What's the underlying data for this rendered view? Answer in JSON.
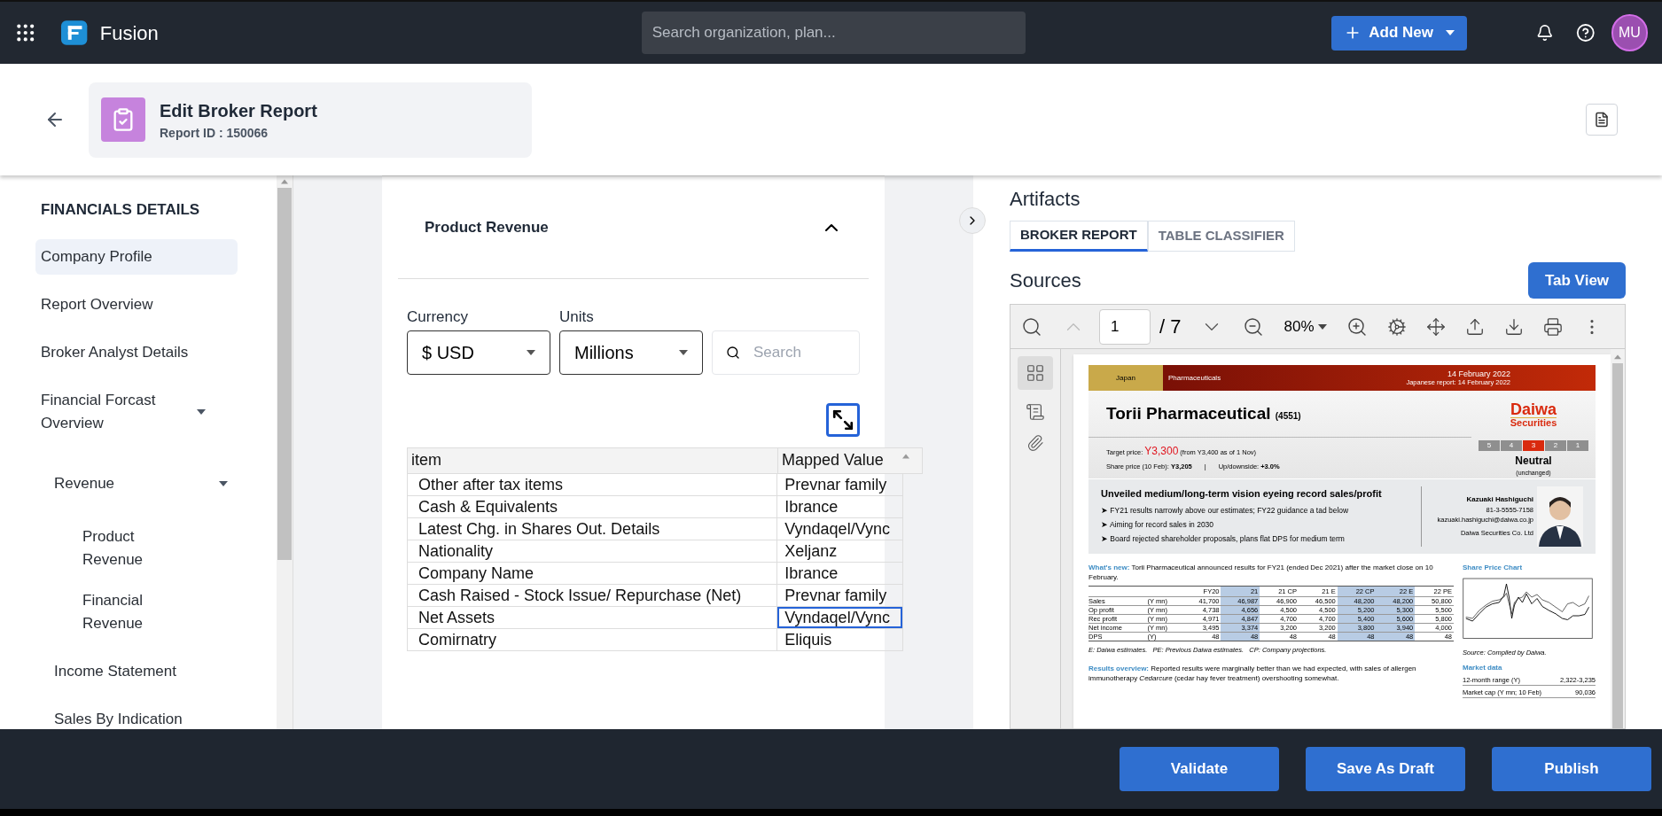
{
  "app": {
    "name": "Fusion"
  },
  "search": {
    "placeholder": "Search organization, plan..."
  },
  "add_button": "Add New",
  "avatar": "MU",
  "page_header": {
    "title": "Edit Broker Report",
    "subtitle": "Report ID : 150066"
  },
  "sidebar": {
    "heading": "FINANCIALS DETAILS",
    "items": [
      {
        "label": "Company Profile",
        "selected": true
      },
      {
        "label": "Report Overview",
        "selected": false
      },
      {
        "label": "Broker Analyst Details",
        "selected": false
      },
      {
        "label": "Financial Forcast Overview",
        "selected": false,
        "expanded": true,
        "children": [
          {
            "label": "Revenue",
            "selected": false,
            "expanded": true,
            "children": [
              {
                "label": "Product Revenue",
                "selected": false
              },
              {
                "label": "Financial Revenue",
                "selected": false
              }
            ]
          },
          {
            "label": "Income Statement",
            "selected": false
          },
          {
            "label": "Sales By Indication",
            "selected": false
          }
        ]
      }
    ]
  },
  "section": {
    "title": "Product Revenue",
    "expanded": true
  },
  "filters": [
    {
      "label": "Currency",
      "value": "$ USD"
    },
    {
      "label": "Units",
      "value": "Millions"
    }
  ],
  "table_search": {
    "placeholder": "Search"
  },
  "table": {
    "columns": [
      "item",
      "Mapped Value"
    ],
    "rows": [
      {
        "item": "Other after tax items",
        "mapped": "Prevnar family",
        "selected": false
      },
      {
        "item": "Cash & Equivalents",
        "mapped": "Ibrance",
        "selected": false
      },
      {
        "item": "Latest Chg. in Shares Out. Details",
        "mapped": "Vyndaqel/Vync",
        "selected": false
      },
      {
        "item": "Nationality",
        "mapped": "Xeljanz",
        "selected": false
      },
      {
        "item": "Company Name",
        "mapped": "Ibrance",
        "selected": false
      },
      {
        "item": "Cash Raised - Stock Issue/ Repurchase (Net)",
        "mapped": "Prevnar family",
        "selected": false
      },
      {
        "item": "Net Assets",
        "mapped": "Vyndaqel/Vync",
        "selected": true
      },
      {
        "item": "Comirnatry",
        "mapped": "Eliquis",
        "selected": false
      }
    ]
  },
  "artifacts": {
    "title": "Artifacts",
    "tabs": [
      {
        "label": "BROKER REPORT",
        "selected": true
      },
      {
        "label": "TABLE CLASSIFIER",
        "selected": false
      }
    ]
  },
  "sources": {
    "title": "Sources",
    "button": "Tab View"
  },
  "viewer": {
    "page": "1",
    "pages": "/ 7",
    "zoom": "80%"
  },
  "document": {
    "region": "Japan",
    "sector": "Pharmaceuticals",
    "date": "14 February 2022",
    "jp_date": "Japanese report: 14 February 2022",
    "logo": [
      "Daiwa",
      "Securities"
    ],
    "company": "Torii Pharmaceutical",
    "code": "(4551)",
    "target_label": "Target price:",
    "target": "Y3,300",
    "target_note": "(from Y3,400 as of 1 Nov)",
    "share_price": "Share price (10 Feb): **Y3,205**",
    "separator": "|",
    "updown": "Up/downside: **+3.0%**",
    "ratings": [
      {
        "label": "5",
        "selected": false
      },
      {
        "label": "4",
        "selected": false
      },
      {
        "label": "3",
        "selected": true
      },
      {
        "label": "2",
        "selected": false
      },
      {
        "label": "1",
        "selected": false
      }
    ],
    "rating": "Neutral",
    "rating_note": "(unchanged)",
    "headline": "Unveiled medium/long-term vision eyeing record sales/profit",
    "bullets": [
      "➤ FY21 results narrowly above our estimates; FY22 guidance a tad below",
      "➤ Aiming for record sales in 2030",
      "➤ Board rejected shareholder proposals, plans flat DPS for medium term"
    ],
    "analyst": {
      "name": "Kazuaki Hashiguchi",
      "phone": "81-3-5555-7158",
      "email": "kazuaki.hashiguchi@daiwa.co.jp",
      "firm": "Daiwa Securities Co. Ltd"
    },
    "whats_new": {
      "label": "What's new:",
      "text": "Torii Pharmaceutical announced results for FY21 (ended Dec 2021) after the market close on 10 February."
    },
    "fin_table": {
      "columns": [
        "FY20",
        "21",
        "21 CP",
        "21 E",
        "22 CP",
        "22 E",
        "22 PE"
      ],
      "rows": [
        {
          "name": "Sales",
          "unit": "(Y mn)",
          "values": [
            "41,700",
            "46,987",
            "46,900",
            "46,500",
            "48,200",
            "48,200",
            "50,800"
          ]
        },
        {
          "name": "Op profit",
          "unit": "(Y mn)",
          "values": [
            "4,738",
            "4,656",
            "4,500",
            "4,500",
            "5,200",
            "5,300",
            "5,500"
          ]
        },
        {
          "name": "Rec profit",
          "unit": "(Y mn)",
          "values": [
            "4,971",
            "4,847",
            "4,700",
            "4,700",
            "5,400",
            "5,600",
            "5,800"
          ]
        },
        {
          "name": "Net income",
          "unit": "(Y mn)",
          "values": [
            "3,495",
            "3,374",
            "3,200",
            "3,200",
            "3,800",
            "3,940",
            "4,000"
          ]
        },
        {
          "name": "DPS",
          "unit": "(Y)",
          "values": [
            "48",
            "48",
            "48",
            "48",
            "48",
            "48",
            "48"
          ]
        }
      ]
    },
    "fin_note": "E: Daiwa estimates.   PE: Previous Daiwa estimates.   CP: Company projections.",
    "results": {
      "label": "Results overview:",
      "text": "Reported results were marginally better than we had expected, with sales of allergen immunotherapy *Cedarcure* (cedar hay fever treatment) overshooting somewhat."
    },
    "chart_title": "Share Price Chart",
    "chart_source": "Source: Compiled by Daiwa.",
    "market_title": "Market data",
    "market": [
      {
        "label": "12-month range (Y)",
        "value": "2,322-3,235"
      },
      {
        "label": "Market cap (Y mn; 10 Feb)",
        "value": "90,036"
      }
    ]
  },
  "footer_buttons": [
    "Validate",
    "Save As Draft",
    "Publish"
  ]
}
